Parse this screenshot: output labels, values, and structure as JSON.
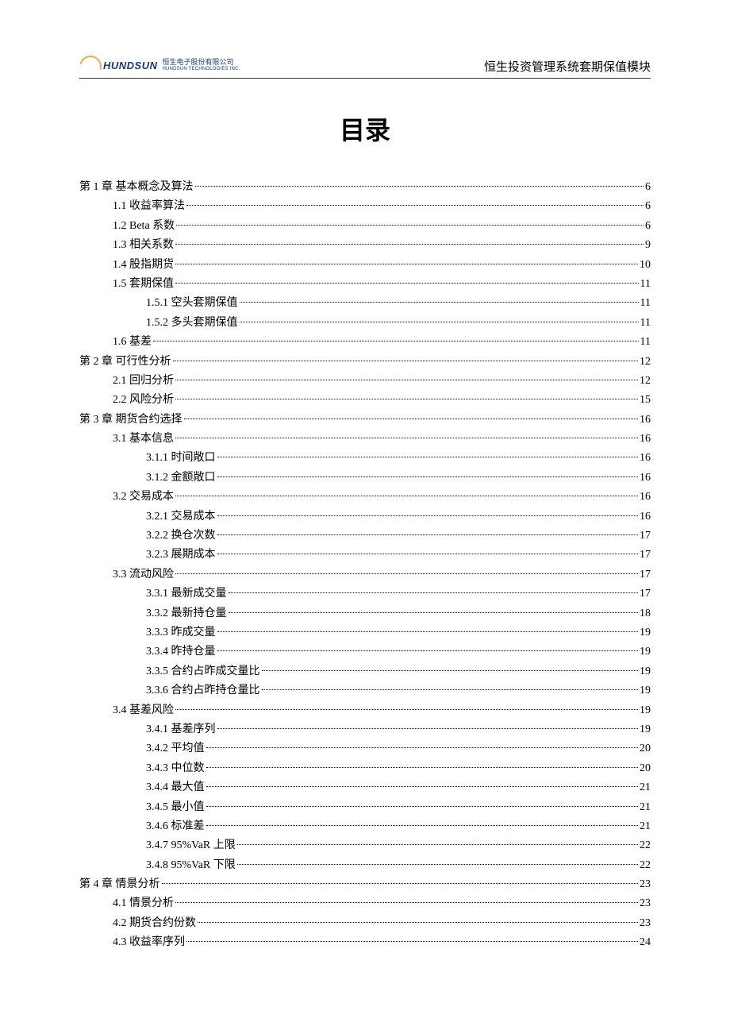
{
  "header": {
    "logo_brand": "HUNDSUN",
    "logo_cn": "恒生电子股份有限公司",
    "logo_en": "HUNDSUN TECHNOLOGIES INC.",
    "doc_title": "恒生投资管理系统套期保值模块"
  },
  "page_title": "目录",
  "toc": [
    {
      "level": 1,
      "label": "第 1 章  基本概念及算法",
      "page": "6"
    },
    {
      "level": 2,
      "label": "1.1 收益率算法",
      "page": "6"
    },
    {
      "level": 2,
      "label": "1.2 Beta 系数",
      "page": "6"
    },
    {
      "level": 2,
      "label": "1.3 相关系数",
      "page": "9"
    },
    {
      "level": 2,
      "label": "1.4 股指期货",
      "page": "10"
    },
    {
      "level": 2,
      "label": "1.5 套期保值",
      "page": "11"
    },
    {
      "level": 3,
      "label": "1.5.1 空头套期保值",
      "page": "11"
    },
    {
      "level": 3,
      "label": "1.5.2 多头套期保值",
      "page": "11"
    },
    {
      "level": 2,
      "label": "1.6 基差",
      "page": "11"
    },
    {
      "level": 1,
      "label": "第 2 章  可行性分析",
      "page": "12"
    },
    {
      "level": 2,
      "label": "2.1 回归分析",
      "page": "12"
    },
    {
      "level": 2,
      "label": "2.2 风险分析",
      "page": "15"
    },
    {
      "level": 1,
      "label": "第 3 章  期货合约选择",
      "page": "16"
    },
    {
      "level": 2,
      "label": "3.1 基本信息",
      "page": "16"
    },
    {
      "level": 3,
      "label": "3.1.1 时间敞口",
      "page": "16"
    },
    {
      "level": 3,
      "label": "3.1.2 金额敞口",
      "page": "16"
    },
    {
      "level": 2,
      "label": "3.2 交易成本",
      "page": "16"
    },
    {
      "level": 3,
      "label": "3.2.1 交易成本",
      "page": "16"
    },
    {
      "level": 3,
      "label": "3.2.2 换仓次数",
      "page": "17"
    },
    {
      "level": 3,
      "label": "3.2.3 展期成本",
      "page": "17"
    },
    {
      "level": 2,
      "label": "3.3 流动风险",
      "page": "17"
    },
    {
      "level": 3,
      "label": "3.3.1 最新成交量",
      "page": "17"
    },
    {
      "level": 3,
      "label": "3.3.2 最新持仓量",
      "page": "18"
    },
    {
      "level": 3,
      "label": "3.3.3 昨成交量",
      "page": "19"
    },
    {
      "level": 3,
      "label": "3.3.4 昨持仓量",
      "page": "19"
    },
    {
      "level": 3,
      "label": "3.3.5 合约占昨成交量比",
      "page": "19"
    },
    {
      "level": 3,
      "label": "3.3.6 合约占昨持仓量比",
      "page": "19"
    },
    {
      "level": 2,
      "label": "3.4 基差风险",
      "page": "19"
    },
    {
      "level": 3,
      "label": "3.4.1 基差序列",
      "page": "19"
    },
    {
      "level": 3,
      "label": "3.4.2 平均值",
      "page": "20"
    },
    {
      "level": 3,
      "label": "3.4.3 中位数",
      "page": "20"
    },
    {
      "level": 3,
      "label": "3.4.4 最大值",
      "page": "21"
    },
    {
      "level": 3,
      "label": "3.4.5 最小值",
      "page": "21"
    },
    {
      "level": 3,
      "label": "3.4.6 标准差",
      "page": "21"
    },
    {
      "level": 3,
      "label": "3.4.7 95%VaR 上限",
      "page": "22"
    },
    {
      "level": 3,
      "label": "3.4.8 95%VaR 下限",
      "page": "22"
    },
    {
      "level": 1,
      "label": "第 4 章  情景分析",
      "page": "23"
    },
    {
      "level": 2,
      "label": "4.1 情景分析",
      "page": "23"
    },
    {
      "level": 2,
      "label": "4.2 期货合约份数",
      "page": "23"
    },
    {
      "level": 2,
      "label": "4.3 收益率序列",
      "page": "24"
    }
  ]
}
